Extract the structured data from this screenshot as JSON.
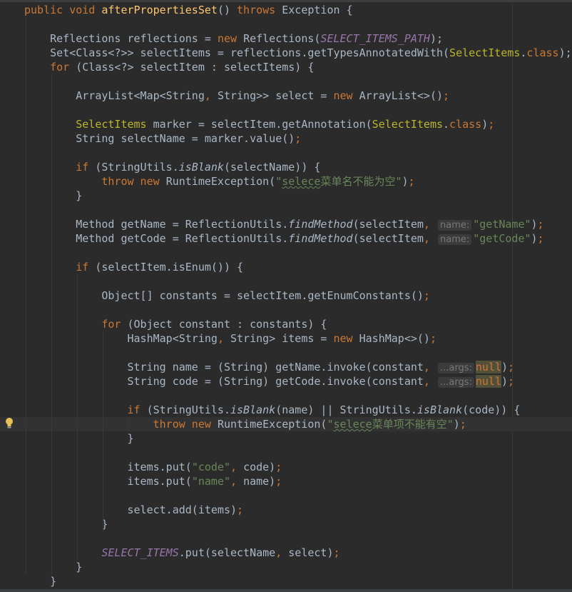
{
  "editor": {
    "colors": {
      "background": "#2B2B2B",
      "keyword": "#CC7832",
      "text": "#A9B7C6",
      "method_declaration": "#FFC66D",
      "string": "#6A8759",
      "static_field": "#9876AA",
      "annotation": "#BBB529"
    },
    "current_line": 29,
    "gutter_icon": "lightbulb-icon",
    "lines": [
      {
        "indent": 0,
        "tokens": [
          [
            "k",
            "public void "
          ],
          [
            "m",
            "afterPropertiesSet"
          ],
          [
            "t",
            "() "
          ],
          [
            "k",
            "throws "
          ],
          [
            "t",
            "Exception {"
          ]
        ]
      },
      {
        "indent": 0,
        "tokens": []
      },
      {
        "indent": 4,
        "tokens": [
          [
            "t",
            "Reflections reflections = "
          ],
          [
            "k",
            "new "
          ],
          [
            "t",
            "Reflections("
          ],
          [
            "c",
            "SELECT_ITEMS_PATH"
          ],
          [
            "t",
            ");"
          ]
        ]
      },
      {
        "indent": 4,
        "tokens": [
          [
            "t",
            "Set<Class<?>> selectItems = reflections.getTypesAnnotatedWith("
          ],
          [
            "a",
            "SelectItems"
          ],
          [
            "t",
            "."
          ],
          [
            "k",
            "class"
          ],
          [
            "t",
            ");"
          ]
        ]
      },
      {
        "indent": 4,
        "tokens": [
          [
            "k",
            "for "
          ],
          [
            "t",
            "(Class<?> selectItem : selectItems) {"
          ]
        ]
      },
      {
        "indent": 0,
        "tokens": []
      },
      {
        "indent": 8,
        "tokens": [
          [
            "t",
            "ArrayList<Map<String"
          ],
          [
            "k",
            ", "
          ],
          [
            "t",
            "String>> select = "
          ],
          [
            "k",
            "new "
          ],
          [
            "t",
            "ArrayList<>()"
          ],
          [
            "k",
            ";"
          ]
        ]
      },
      {
        "indent": 0,
        "tokens": []
      },
      {
        "indent": 8,
        "tokens": [
          [
            "a",
            "SelectItems "
          ],
          [
            "t",
            "marker = selectItem.getAnnotation("
          ],
          [
            "a",
            "SelectItems"
          ],
          [
            "t",
            "."
          ],
          [
            "k",
            "class"
          ],
          [
            "t",
            ")"
          ],
          [
            "k",
            ";"
          ]
        ]
      },
      {
        "indent": 8,
        "tokens": [
          [
            "t",
            "String selectName = marker.value()"
          ],
          [
            "k",
            ";"
          ]
        ]
      },
      {
        "indent": 0,
        "tokens": []
      },
      {
        "indent": 8,
        "tokens": [
          [
            "k",
            "if "
          ],
          [
            "t",
            "(StringUtils."
          ],
          [
            "i",
            "isBlank"
          ],
          [
            "t",
            "(selectName)) {"
          ]
        ]
      },
      {
        "indent": 12,
        "tokens": [
          [
            "k",
            "throw new "
          ],
          [
            "t",
            "RuntimeException("
          ],
          [
            "s",
            "\""
          ],
          [
            "sw",
            "selece"
          ],
          [
            "s",
            "菜单名不能为空\""
          ],
          [
            "t",
            ")"
          ],
          [
            "k",
            ";"
          ]
        ]
      },
      {
        "indent": 8,
        "tokens": [
          [
            "t",
            "}"
          ]
        ]
      },
      {
        "indent": 0,
        "tokens": []
      },
      {
        "indent": 8,
        "tokens": [
          [
            "t",
            "Method getName = ReflectionUtils."
          ],
          [
            "i",
            "findMethod"
          ],
          [
            "t",
            "(selectItem"
          ],
          [
            "k",
            ", "
          ],
          [
            "h",
            "name:"
          ],
          [
            "s",
            "\"getName\""
          ],
          [
            "t",
            ")"
          ],
          [
            "k",
            ";"
          ]
        ]
      },
      {
        "indent": 8,
        "tokens": [
          [
            "t",
            "Method getCode = ReflectionUtils."
          ],
          [
            "i",
            "findMethod"
          ],
          [
            "t",
            "(selectItem"
          ],
          [
            "k",
            ", "
          ],
          [
            "h",
            "name:"
          ],
          [
            "s",
            "\"getCode\""
          ],
          [
            "t",
            ")"
          ],
          [
            "k",
            ";"
          ]
        ]
      },
      {
        "indent": 0,
        "tokens": []
      },
      {
        "indent": 8,
        "tokens": [
          [
            "k",
            "if "
          ],
          [
            "t",
            "(selectItem.isEnum()) {"
          ]
        ]
      },
      {
        "indent": 0,
        "tokens": []
      },
      {
        "indent": 12,
        "tokens": [
          [
            "t",
            "Object[] constants = selectItem.getEnumConstants()"
          ],
          [
            "k",
            ";"
          ]
        ]
      },
      {
        "indent": 0,
        "tokens": []
      },
      {
        "indent": 12,
        "tokens": [
          [
            "k",
            "for "
          ],
          [
            "t",
            "(Object constant : constants) {"
          ]
        ]
      },
      {
        "indent": 16,
        "tokens": [
          [
            "t",
            "HashMap<String"
          ],
          [
            "k",
            ", "
          ],
          [
            "t",
            "String> items = "
          ],
          [
            "k",
            "new "
          ],
          [
            "t",
            "HashMap<>()"
          ],
          [
            "k",
            ";"
          ]
        ]
      },
      {
        "indent": 0,
        "tokens": []
      },
      {
        "indent": 16,
        "tokens": [
          [
            "t",
            "String name = (String) getName.invoke(constant"
          ],
          [
            "k",
            ", "
          ],
          [
            "h",
            "...args:"
          ],
          [
            "n",
            "null"
          ],
          [
            "t",
            ")"
          ],
          [
            "k",
            ";"
          ]
        ]
      },
      {
        "indent": 16,
        "tokens": [
          [
            "t",
            "String code = (String) getCode.invoke(constant"
          ],
          [
            "k",
            ", "
          ],
          [
            "h",
            "...args:"
          ],
          [
            "n",
            "null"
          ],
          [
            "t",
            ")"
          ],
          [
            "k",
            ";"
          ]
        ]
      },
      {
        "indent": 0,
        "tokens": []
      },
      {
        "indent": 16,
        "tokens": [
          [
            "k",
            "if "
          ],
          [
            "t",
            "(StringUtils."
          ],
          [
            "i",
            "isBlank"
          ],
          [
            "t",
            "(name) || StringUtils."
          ],
          [
            "i",
            "isBlank"
          ],
          [
            "t",
            "(code)) {"
          ]
        ]
      },
      {
        "indent": 20,
        "tokens": [
          [
            "k",
            "throw new "
          ],
          [
            "t",
            "RuntimeException("
          ],
          [
            "s",
            "\""
          ],
          [
            "sw",
            "selece"
          ],
          [
            "s",
            "菜单项不能有空\""
          ],
          [
            "t",
            ")"
          ],
          [
            "k",
            ";"
          ]
        ]
      },
      {
        "indent": 16,
        "tokens": [
          [
            "t",
            "}"
          ]
        ]
      },
      {
        "indent": 0,
        "tokens": []
      },
      {
        "indent": 16,
        "tokens": [
          [
            "t",
            "items.put("
          ],
          [
            "s",
            "\"code\""
          ],
          [
            "k",
            ", "
          ],
          [
            "t",
            "code)"
          ],
          [
            "k",
            ";"
          ]
        ]
      },
      {
        "indent": 16,
        "tokens": [
          [
            "t",
            "items.put("
          ],
          [
            "s",
            "\"name\""
          ],
          [
            "k",
            ", "
          ],
          [
            "t",
            "name)"
          ],
          [
            "k",
            ";"
          ]
        ]
      },
      {
        "indent": 0,
        "tokens": []
      },
      {
        "indent": 16,
        "tokens": [
          [
            "t",
            "select.add(items)"
          ],
          [
            "k",
            ";"
          ]
        ]
      },
      {
        "indent": 12,
        "tokens": [
          [
            "t",
            "}"
          ]
        ]
      },
      {
        "indent": 0,
        "tokens": []
      },
      {
        "indent": 12,
        "tokens": [
          [
            "c",
            "SELECT_ITEMS"
          ],
          [
            "t",
            ".put(selectName"
          ],
          [
            "k",
            ", "
          ],
          [
            "t",
            "select)"
          ],
          [
            "k",
            ";"
          ]
        ]
      },
      {
        "indent": 8,
        "tokens": [
          [
            "t",
            "}"
          ]
        ]
      },
      {
        "indent": 4,
        "tokens": [
          [
            "t",
            "}"
          ]
        ]
      }
    ]
  }
}
